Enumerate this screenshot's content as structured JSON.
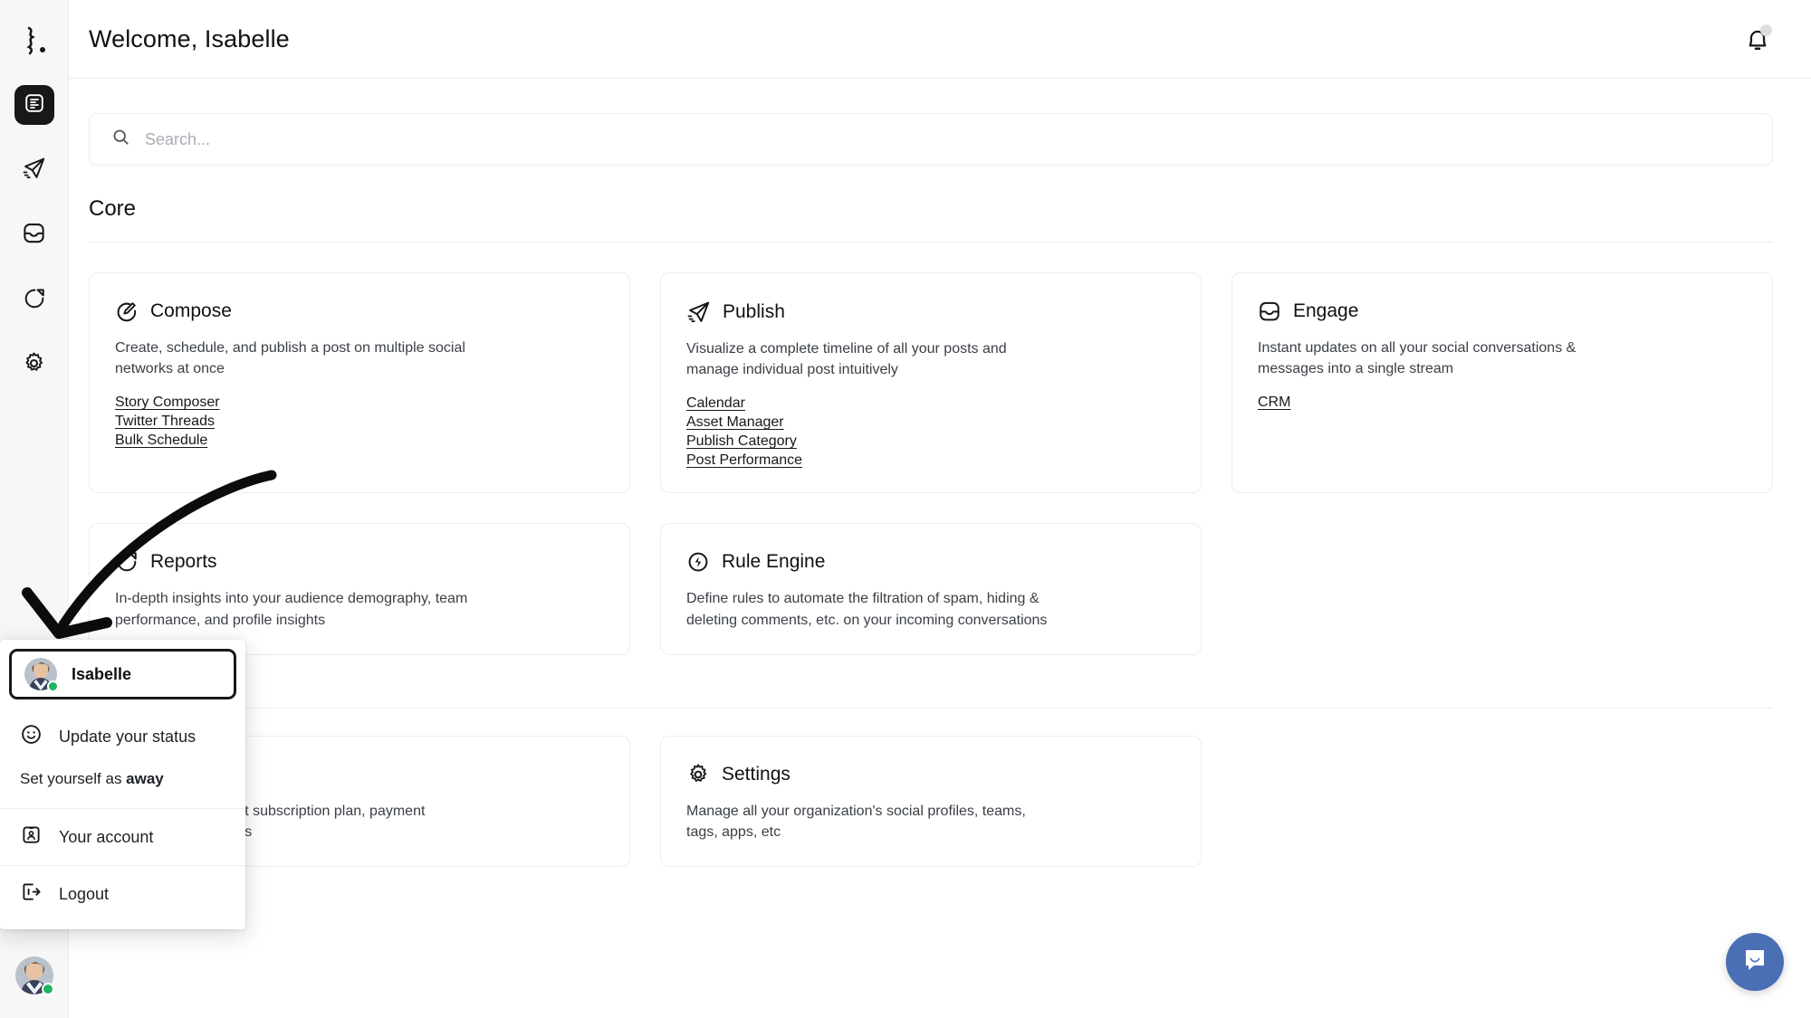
{
  "header": {
    "title": "Welcome, Isabelle",
    "notifications_icon": "bell-icon"
  },
  "search": {
    "placeholder": "Search...",
    "value": "",
    "icon": "search-icon"
  },
  "sidebar": {
    "logo": "brand-logo",
    "items": [
      {
        "icon": "dashboard-icon",
        "name": "dashboard",
        "active": true
      },
      {
        "icon": "publish-paper-plane-icon",
        "name": "publish",
        "active": false
      },
      {
        "icon": "engage-inbox-icon",
        "name": "engage",
        "active": false
      },
      {
        "icon": "reports-pie-chart-icon",
        "name": "reports",
        "active": false
      },
      {
        "icon": "settings-gear-icon",
        "name": "settings",
        "active": false
      }
    ],
    "avatar": {
      "name": "Isabelle",
      "presence": "online",
      "presence_color": "#1fb563"
    }
  },
  "sections": [
    {
      "title": "Core",
      "cards": [
        {
          "title": "Compose",
          "icon": "compose-pencil-icon",
          "desc": "Create, schedule, and publish a post on multiple social networks at once",
          "links": [
            "Story Composer",
            "Twitter Threads",
            "Bulk Schedule"
          ]
        },
        {
          "title": "Publish",
          "icon": "publish-paper-plane-icon",
          "desc": "Visualize a complete timeline of all your posts and manage individual post intuitively",
          "links": [
            "Calendar",
            "Asset Manager",
            "Publish Category",
            "Post Performance"
          ]
        },
        {
          "title": "Engage",
          "icon": "engage-inbox-icon",
          "desc": "Instant updates on all your social conversations & messages into a single stream",
          "links": [
            "CRM"
          ]
        },
        {
          "title": "Reports",
          "icon": "reports-pie-chart-icon",
          "desc": "In-depth insights into your audience demography, team performance, and profile insights",
          "links": []
        },
        {
          "title": "Rule Engine",
          "icon": "rule-engine-bolt-icon",
          "desc": "Define rules to automate the filtration of spam, hiding & deleting comments, etc. on your incoming conversations",
          "links": []
        }
      ]
    },
    {
      "title": "",
      "cards": [
        {
          "title": "",
          "icon": "billing-card-icon",
          "desc": "Manage your current subscription plan, payment method, and invoices",
          "links": []
        },
        {
          "title": "Settings",
          "icon": "settings-gear-icon",
          "desc": "Manage all your organization's social profiles, teams, tags, apps, etc",
          "links": []
        }
      ]
    }
  ],
  "user_menu": {
    "user": {
      "name": "Isabelle",
      "presence": "online"
    },
    "status_item": {
      "label": "Update your status",
      "icon": "smiley-icon"
    },
    "away_prefix": "Set yourself as ",
    "away_bold": "away",
    "items": [
      {
        "label": "Your account",
        "icon": "account-badge-icon"
      },
      {
        "label": "Logout",
        "icon": "logout-icon"
      }
    ]
  },
  "chat_widget": {
    "icon": "intercom-chat-icon",
    "color": "#4a6fb4"
  },
  "annotation": {
    "type": "arrow",
    "points_to": "user-menu-profile-row"
  }
}
